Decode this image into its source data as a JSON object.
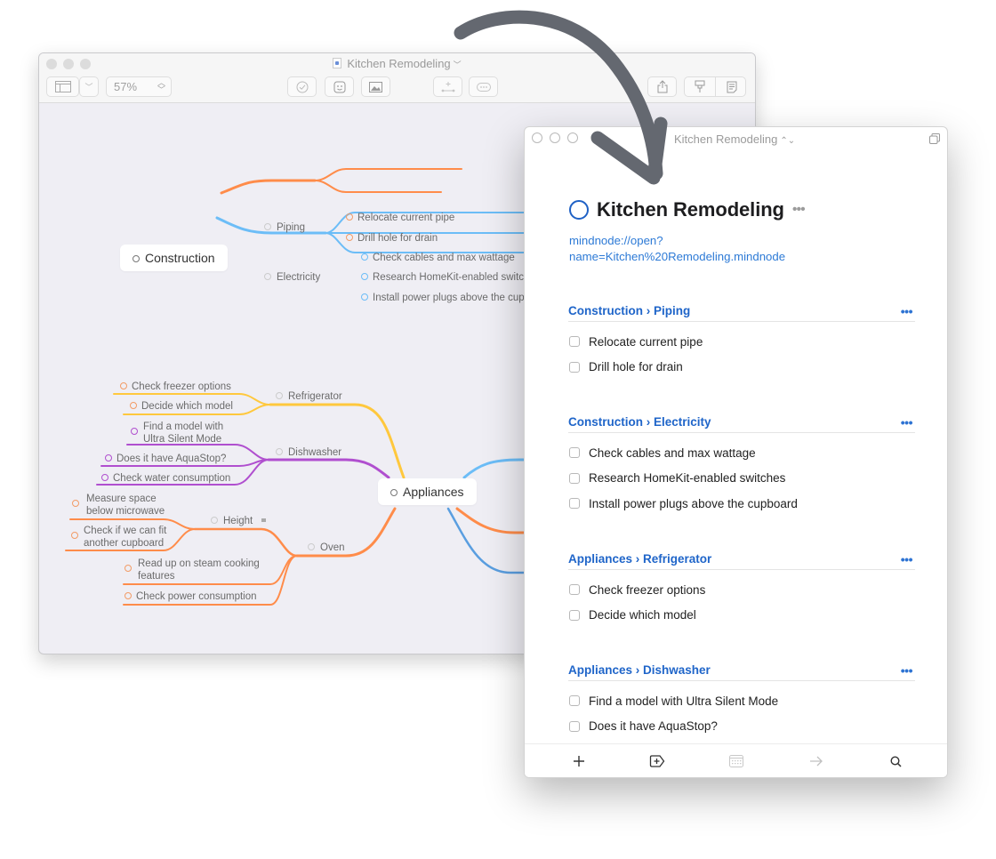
{
  "mac_window": {
    "title": "Kitchen Remodeling",
    "zoom_level": "57%",
    "toolbar": {
      "sidebar_toggle": "sidebar-icon",
      "sidebar_menu": "chevron-down-icon",
      "task": "checkmark-icon",
      "sticker": "sticker-icon",
      "image": "image-icon",
      "add_node": "add-node-icon",
      "more": "more-icon",
      "share": "share-icon",
      "style": "brush-icon",
      "outline": "outline-icon"
    },
    "mindmap": {
      "construction": {
        "label": "Construction",
        "color": "#ff8c4a",
        "piping": {
          "label": "Piping",
          "tasks": [
            "Relocate current pipe",
            "Drill hole for drain"
          ]
        },
        "electricity": {
          "label": "Electricity",
          "color": "#6cbdf7",
          "tasks": [
            "Check cables and max wattage",
            "Research HomeKit-enabled switches",
            "Install power plugs above the cupboard"
          ]
        }
      },
      "appliances": {
        "label": "Appliances",
        "refrigerator": {
          "label": "Refrigerator",
          "color": "#ffc83d",
          "tasks": [
            "Check freezer options",
            "Decide which model"
          ]
        },
        "dishwasher": {
          "label": "Dishwasher",
          "color": "#b04fcf",
          "tasks": [
            "Find a model with Ultra Silent Mode",
            "Does it have AquaStop?",
            "Check water consumption"
          ]
        },
        "oven": {
          "label": "Oven",
          "color": "#ff8c4a",
          "height": {
            "label": "Height",
            "tasks": [
              "Measure space below microwave",
              "Check if we can fit another cupboard"
            ]
          },
          "tasks": [
            "Read up on steam cooking features",
            "Check power consumption"
          ]
        }
      }
    }
  },
  "ios_window": {
    "title": "Kitchen Remodeling",
    "document_title": "Kitchen Remodeling",
    "link_line1": "mindnode://open?",
    "link_line2": "name=Kitchen%20Remodeling.mindnode",
    "more_label": "•••",
    "accent": "#1f65c9",
    "sections": [
      {
        "crumb": "Construction › Piping",
        "tasks": [
          "Relocate current pipe",
          "Drill hole for drain"
        ]
      },
      {
        "crumb": "Construction › Electricity",
        "tasks": [
          "Check cables and max wattage",
          "Research HomeKit-enabled switches",
          "Install power plugs above the cupboard"
        ]
      },
      {
        "crumb": "Appliances › Refrigerator",
        "tasks": [
          "Check freezer options",
          "Decide which model"
        ]
      },
      {
        "crumb": "Appliances › Dishwasher",
        "tasks": [
          "Find a model with Ultra Silent Mode",
          "Does it have AquaStop?"
        ]
      }
    ],
    "footer": [
      "plus-icon",
      "add-tag-icon",
      "calendar-icon",
      "arrow-right-icon",
      "search-icon"
    ]
  }
}
